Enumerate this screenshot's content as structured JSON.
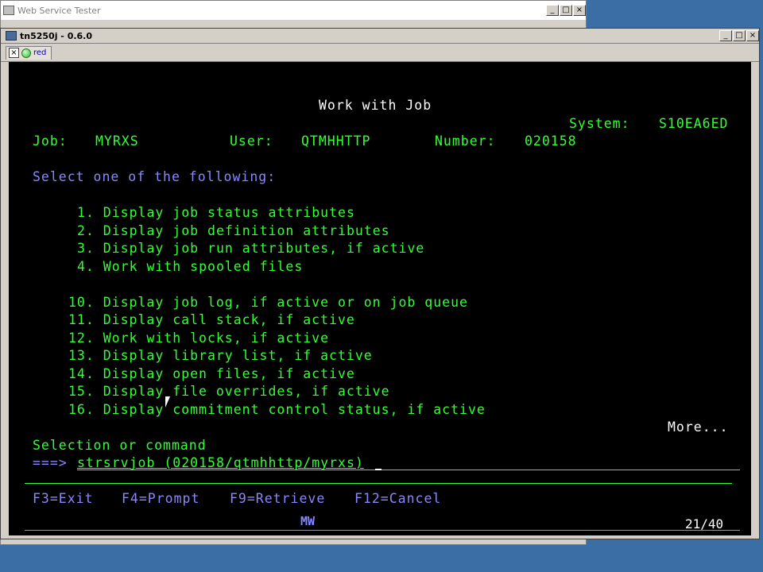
{
  "background_window": {
    "title": "Web Service Tester"
  },
  "window": {
    "title": "tn5250j - 0.6.0"
  },
  "window_buttons": {
    "minimize": "_",
    "maximize": "□",
    "close": "×"
  },
  "tab": {
    "close": "×",
    "label": "red"
  },
  "screen": {
    "heading": "Work with Job",
    "system_label": "System:",
    "system_value": "S10EA6ED",
    "job_label": "Job:",
    "job_value": "MYRXS",
    "user_label": "User:",
    "user_value": "QTMHHTTP",
    "number_label": "Number:",
    "number_value": "020158",
    "instruction": "Select one of the following:",
    "options": [
      "1. Display job status attributes",
      "2. Display job definition attributes",
      "3. Display job run attributes, if active",
      "4. Work with spooled files",
      "10. Display job log, if active or on job queue",
      "11. Display call stack, if active",
      "12. Work with locks, if active",
      "13. Display library list, if active",
      "14. Display open files, if active",
      "15. Display file overrides, if active",
      "16. Display commitment control status, if active"
    ],
    "more": "More...",
    "selection_label": "Selection or command",
    "prompt": "===>",
    "command_value": "strsrvjob (020158/qtmhhttp/myrxs)",
    "function_keys": [
      "F3=Exit",
      "F4=Prompt",
      "F9=Retrieve",
      "F12=Cancel"
    ],
    "status_indicator": "MW",
    "cursor_position": "21/40"
  },
  "colors": {
    "terminal_bg": "#000000",
    "green": "#33ff33",
    "white": "#ffffff",
    "blue": "#8888ff"
  }
}
